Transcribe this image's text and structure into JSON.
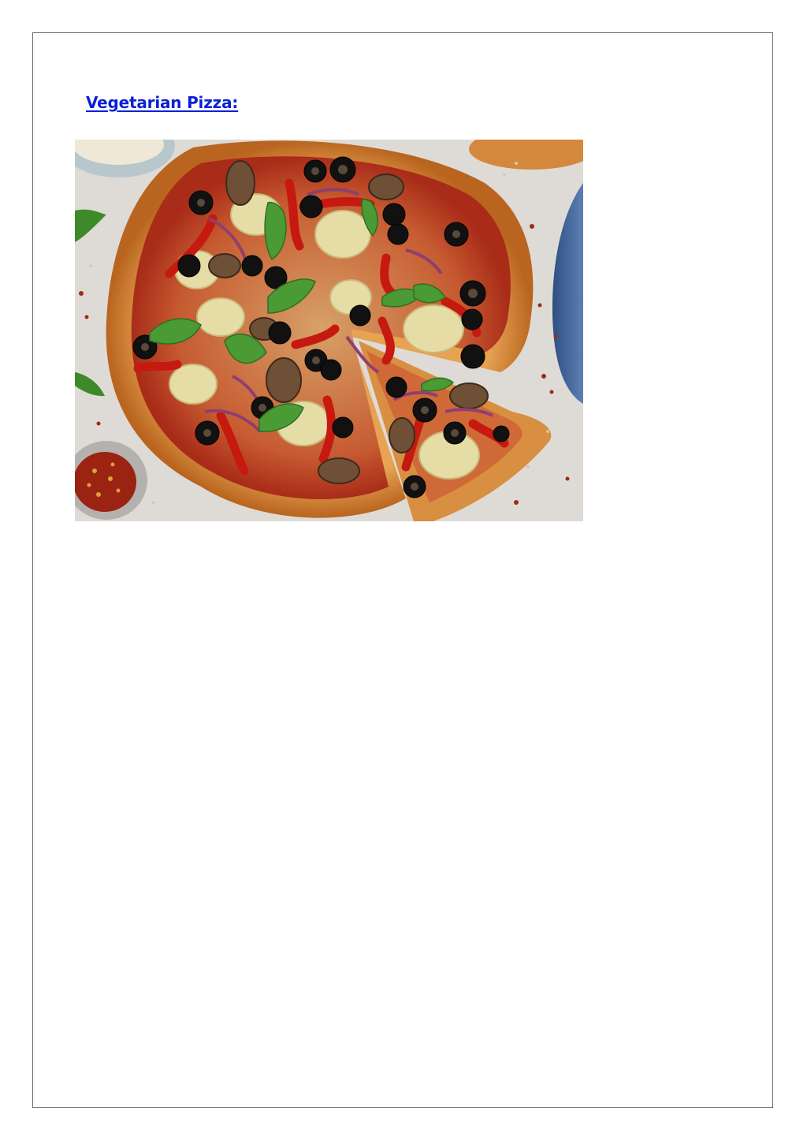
{
  "document": {
    "heading": "Vegetarian Pizza:"
  },
  "image": {
    "subject": "vegetarian pizza photo",
    "colors": {
      "background": "#dcd9d6",
      "crust": "#d98a3a",
      "sauce": "#b8321c",
      "cheese": "#e6c58a",
      "olive": "#141414",
      "basil": "#3e8a2c",
      "pepper": "#c81e14",
      "artichoke": "#e3d9a2",
      "cloth": "#3b5f95"
    }
  }
}
